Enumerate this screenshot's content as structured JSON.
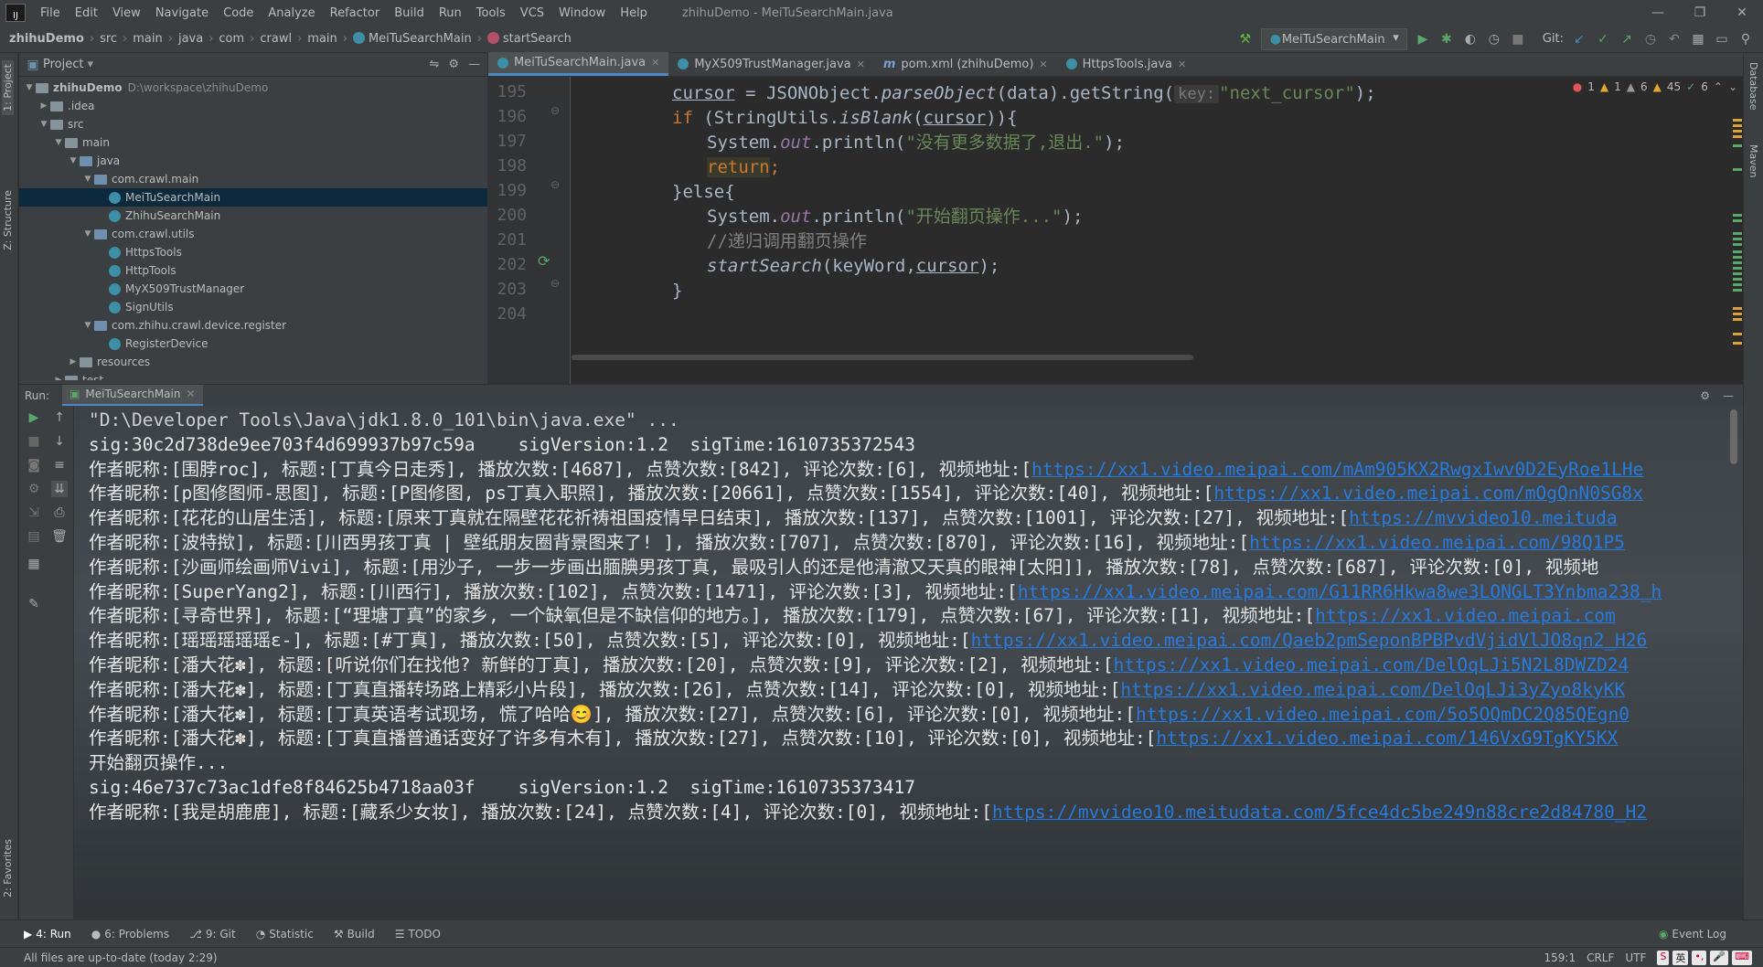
{
  "window": {
    "title": "zhihuDemo - MeiTuSearchMain.java",
    "menu": [
      "File",
      "Edit",
      "View",
      "Navigate",
      "Code",
      "Analyze",
      "Refactor",
      "Build",
      "Run",
      "Tools",
      "VCS",
      "Window",
      "Help"
    ]
  },
  "breadcrumb": [
    "zhihuDemo",
    "src",
    "main",
    "java",
    "com",
    "crawl",
    "main",
    "MeiTuSearchMain",
    "startSearch"
  ],
  "toolbar": {
    "run_config": "MeiTuSearchMain",
    "git_label": "Git:"
  },
  "project": {
    "header": "Project",
    "tree": [
      {
        "label": "zhihuDemo",
        "path": "D:\\workspace\\zhihuDemo",
        "indent": 0,
        "type": "root",
        "expanded": true
      },
      {
        "label": ".idea",
        "indent": 1,
        "type": "folder",
        "expanded": false
      },
      {
        "label": "src",
        "indent": 1,
        "type": "folder",
        "expanded": true
      },
      {
        "label": "main",
        "indent": 2,
        "type": "folder",
        "expanded": true
      },
      {
        "label": "java",
        "indent": 3,
        "type": "folder-blue",
        "expanded": true
      },
      {
        "label": "com.crawl.main",
        "indent": 4,
        "type": "package",
        "expanded": true
      },
      {
        "label": "MeiTuSearchMain",
        "indent": 5,
        "type": "class",
        "selected": true
      },
      {
        "label": "ZhihuSearchMain",
        "indent": 5,
        "type": "class"
      },
      {
        "label": "com.crawl.utils",
        "indent": 4,
        "type": "package",
        "expanded": true
      },
      {
        "label": "HttpsTools",
        "indent": 5,
        "type": "class"
      },
      {
        "label": "HttpTools",
        "indent": 5,
        "type": "class"
      },
      {
        "label": "MyX509TrustManager",
        "indent": 5,
        "type": "class"
      },
      {
        "label": "SignUtils",
        "indent": 5,
        "type": "class"
      },
      {
        "label": "com.zhihu.crawl.device.register",
        "indent": 4,
        "type": "package",
        "expanded": true
      },
      {
        "label": "RegisterDevice",
        "indent": 5,
        "type": "class"
      },
      {
        "label": "resources",
        "indent": 3,
        "type": "folder",
        "expanded": false
      },
      {
        "label": "test",
        "indent": 2,
        "type": "folder",
        "expanded": false
      }
    ]
  },
  "editor": {
    "tabs": [
      {
        "label": "MeiTuSearchMain.java",
        "active": true,
        "kind": "class"
      },
      {
        "label": "MyX509TrustManager.java",
        "active": false,
        "kind": "class"
      },
      {
        "label": "pom.xml (zhihuDemo)",
        "active": false,
        "kind": "maven"
      },
      {
        "label": "HttpsTools.java",
        "active": false,
        "kind": "class"
      }
    ],
    "line_numbers": [
      "195",
      "196",
      "197",
      "198",
      "199",
      "200",
      "201",
      "202",
      "203",
      "204"
    ],
    "inspections": {
      "errors": "1",
      "warnings1": "1",
      "warnings2": "6",
      "weak": "45",
      "ok": "6"
    },
    "code": {
      "l195_a": "cursor",
      "l195_b": " = JSONObject.",
      "l195_c": "parseObject",
      "l195_d": "(data).getString(",
      "l195_hint": "key:",
      "l195_str": "\"next_cursor\"",
      "l195_end": ");",
      "l196_kw": "if",
      "l196_a": " (StringUtils.",
      "l196_b": "isBlank",
      "l196_c": "(",
      "l196_d": "cursor",
      "l196_e": ")){",
      "l197_a": "System.",
      "l197_out": "out",
      "l197_b": ".println(",
      "l197_str": "\"没有更多数据了,退出.\"",
      "l197_end": ");",
      "l198_kw": "return",
      "l198_end": ";",
      "l199": "}else{",
      "l200_a": "System.",
      "l200_out": "out",
      "l200_b": ".println(",
      "l200_str": "\"开始翻页操作...\"",
      "l200_end": ");",
      "l201_cmt": "//递归调用翻页操作",
      "l202_a": "startSearch",
      "l202_b": "(keyWord,",
      "l202_c": "cursor",
      "l202_d": ");",
      "l203": "}"
    }
  },
  "run": {
    "label": "Run:",
    "tab": "MeiTuSearchMain",
    "console": [
      {
        "text": "\"D:\\Developer Tools\\Java\\jdk1.8.0_101\\bin\\java.exe\" ...",
        "link": ""
      },
      {
        "text": "sig:30c2d738de9ee703f4d699937b97c59a    sigVersion:1.2  sigTime:1610735372543",
        "link": ""
      },
      {
        "text": "作者昵称:[围脖roc], 标题:[丁真今日走秀], 播放次数:[4687], 点赞次数:[842], 评论次数:[6], 视频地址:[",
        "link": "https://xx1.video.meipai.com/mAm905KX2RwgxIwv0D2EyRoe1LHe"
      },
      {
        "text": "作者昵称:[p图修图师-思图], 标题:[P图修图, ps丁真入职照], 播放次数:[20661], 点赞次数:[1554], 评论次数:[40], 视频地址:[",
        "link": "https://xx1.video.meipai.com/mOgQnN0SG8x"
      },
      {
        "text": "作者昵称:[花花的山居生活], 标题:[原来丁真就在隔壁花花祈祷祖国疫情早日结束], 播放次数:[137], 点赞次数:[1001], 评论次数:[27], 视频地址:[",
        "link": "https://mvvideo10.meituda"
      },
      {
        "text": "作者昵称:[波特揿], 标题:[川西男孩丁真 | 壁纸朋友圈背景图来了! ], 播放次数:[707], 点赞次数:[870], 评论次数:[16], 视频地址:[",
        "link": "https://xx1.video.meipai.com/98Q1P5"
      },
      {
        "text": "作者昵称:[沙画师绘画师Vivi], 标题:[用沙子, 一步一步画出腼腆男孩丁真, 最吸引人的还是他清澈又天真的眼神[太阳]], 播放次数:[78], 点赞次数:[687], 评论次数:[0], 视频地",
        "link": ""
      },
      {
        "text": "作者昵称:[SuperYang2], 标题:[川西行], 播放次数:[102], 点赞次数:[1471], 评论次数:[3], 视频地址:[",
        "link": "https://xx1.video.meipai.com/G11RR6Hkwa8we3LONGLT3Ynbma238_h"
      },
      {
        "text": "作者昵称:[寻奇世界], 标题:[“理塘丁真”的家乡, 一个缺氧但是不缺信仰的地方。], 播放次数:[179], 点赞次数:[67], 评论次数:[1], 视频地址:[",
        "link": "https://xx1.video.meipai.com"
      },
      {
        "text": "作者昵称:[瑶瑶瑶瑶瑶ε-], 标题:[#丁真], 播放次数:[50], 点赞次数:[5], 评论次数:[0], 视频地址:[",
        "link": "https://xx1.video.meipai.com/Qaeb2pmSeponBPBPvdVjidVlJO8qn2_H26"
      },
      {
        "text": "作者昵称:[潘大花✽], 标题:[听说你们在找他? 新鲜的丁真], 播放次数:[20], 点赞次数:[9], 评论次数:[2], 视频地址:[",
        "link": "https://xx1.video.meipai.com/DelOqLJi5N2L8DWZD24"
      },
      {
        "text": "作者昵称:[潘大花✽], 标题:[丁真直播转场路上精彩小片段], 播放次数:[26], 点赞次数:[14], 评论次数:[0], 视频地址:[",
        "link": "https://xx1.video.meipai.com/DelOqLJi3yZyo8kyKK"
      },
      {
        "text": "作者昵称:[潘大花✽], 标题:[丁真英语考试现场, 慌了哈哈😊], 播放次数:[27], 点赞次数:[6], 评论次数:[0], 视频地址:[",
        "link": "https://xx1.video.meipai.com/5o5OQmDC2Q85QEgn0"
      },
      {
        "text": "作者昵称:[潘大花✽], 标题:[丁真直播普通话变好了许多有木有], 播放次数:[27], 点赞次数:[10], 评论次数:[0], 视频地址:[",
        "link": "https://xx1.video.meipai.com/146VxG9TgKY5KX"
      },
      {
        "text": "开始翻页操作...",
        "link": ""
      },
      {
        "text": "sig:46e737c73ac1dfe8f84625b4718aa03f    sigVersion:1.2  sigTime:1610735373417",
        "link": ""
      },
      {
        "text": "作者昵称:[我是胡鹿鹿], 标题:[藏系少女妆], 播放次数:[24], 点赞次数:[4], 评论次数:[0], 视频地址:[",
        "link": "https://mvvideo10.meitudata.com/5fce4dc5be249n88cre2d84780_H2"
      }
    ]
  },
  "bottom_tools": [
    {
      "label": "4: Run",
      "icon": "▶",
      "active": true
    },
    {
      "label": "6: Problems",
      "icon": "●",
      "active": false
    },
    {
      "label": "9: Git",
      "icon": "⎇",
      "active": false
    },
    {
      "label": "Statistic",
      "icon": "◔",
      "active": false
    },
    {
      "label": "Build",
      "icon": "⚒",
      "active": false
    },
    {
      "label": "TODO",
      "icon": "☰",
      "active": false
    }
  ],
  "event_log": "Event Log",
  "status": {
    "message": "All files are up-to-date (today 2:29)",
    "position": "159:1",
    "line_sep": "CRLF",
    "encoding": "UTF",
    "ime": "英"
  },
  "left_tabs": {
    "project": "1: Project",
    "structure": "Z: Structure",
    "favorites": "2: Favorites"
  },
  "right_tabs": {
    "database": "Database",
    "maven": "Maven"
  }
}
